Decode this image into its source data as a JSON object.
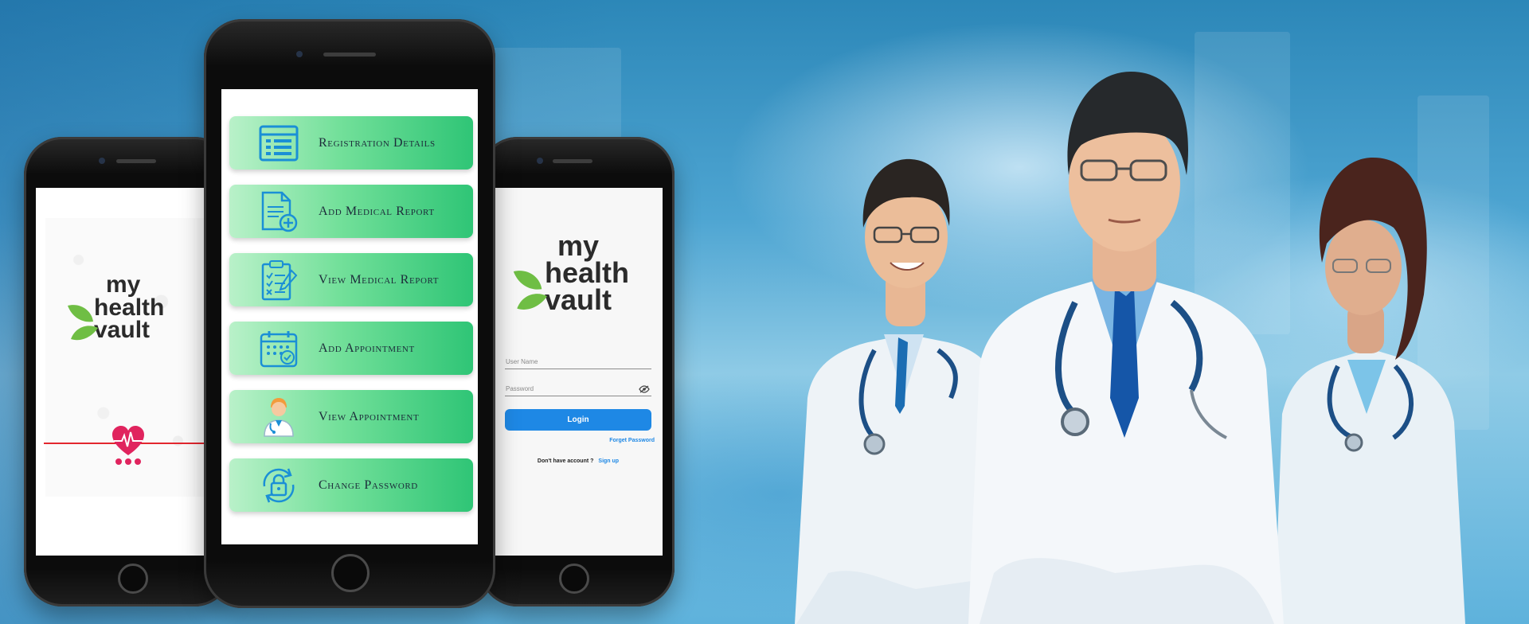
{
  "brand": {
    "logo_line1": "my",
    "logo_line2": "health",
    "logo_line3": "vault",
    "leaf_color": "#6fbe44",
    "text_color": "#2b2b2b"
  },
  "splash": {
    "icons": [
      "heart-icon",
      "ecg-line",
      "loading-dots"
    ],
    "heart_color": "#e0245e"
  },
  "menu": {
    "items": [
      {
        "label": "Registration Details",
        "icon": "registration-icon"
      },
      {
        "label": "Add Medical Report",
        "icon": "add-report-icon"
      },
      {
        "label": "View Medical Report",
        "icon": "view-report-icon"
      },
      {
        "label": "Add Appointment",
        "icon": "calendar-icon"
      },
      {
        "label": "View Appointment",
        "icon": "doctor-icon"
      },
      {
        "label": "Change Password",
        "icon": "lock-icon"
      }
    ],
    "gradient_start": "#b9f1c9",
    "gradient_end": "#2fc576"
  },
  "login": {
    "username_placeholder": "User Name",
    "password_placeholder": "Password",
    "login_label": "Login",
    "forget_label": "Forget Password",
    "no_account_text": "Don't have account ?",
    "signup_label": "Sign up",
    "accent": "#1e88e5"
  }
}
